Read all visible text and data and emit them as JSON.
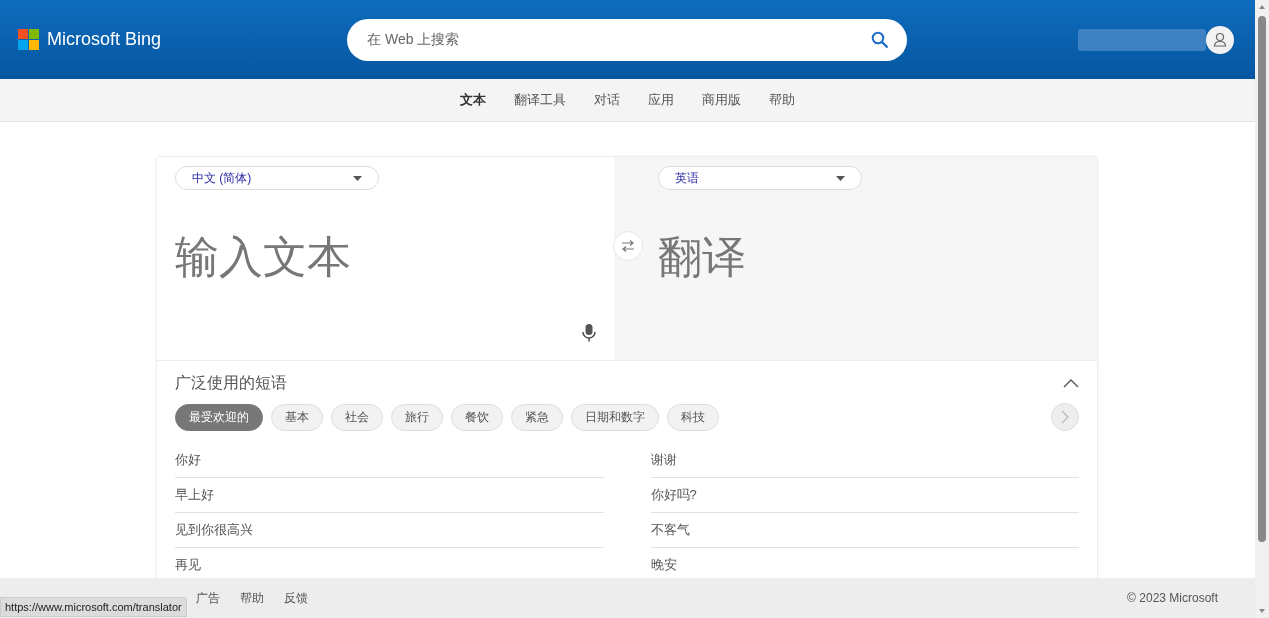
{
  "header": {
    "brand": "Microsoft Bing",
    "search": {
      "placeholder": "在 Web 上搜索"
    }
  },
  "nav": [
    {
      "label": "文本",
      "selected": true
    },
    {
      "label": "翻译工具",
      "selected": false
    },
    {
      "label": "对话",
      "selected": false
    },
    {
      "label": "应用",
      "selected": false
    },
    {
      "label": "商用版",
      "selected": false
    },
    {
      "label": "帮助",
      "selected": false
    }
  ],
  "translator": {
    "source_language": "中文 (简体)",
    "target_language": "英语",
    "input": {
      "placeholder": "输入文本"
    },
    "output": "翻译"
  },
  "phrases": {
    "title": "广泛使用的短语",
    "expanded": true,
    "categories": [
      {
        "label": "最受欢迎的",
        "selected": true
      },
      {
        "label": "基本",
        "selected": false
      },
      {
        "label": "社会",
        "selected": false
      },
      {
        "label": "旅行",
        "selected": false
      },
      {
        "label": "餐饮",
        "selected": false
      },
      {
        "label": "紧急",
        "selected": false
      },
      {
        "label": "日期和数字",
        "selected": false
      },
      {
        "label": "科技",
        "selected": false
      }
    ],
    "left": [
      "你好",
      "早上好",
      "见到你很高兴",
      "再见"
    ],
    "right": [
      "谢谢",
      "你好吗?",
      "不客气",
      "晚安"
    ]
  },
  "footer": {
    "links": [
      "广告",
      "帮助",
      "反馈"
    ],
    "copyright": "© 2023 Microsoft"
  },
  "status_url": "https://www.microsoft.com/translator"
}
